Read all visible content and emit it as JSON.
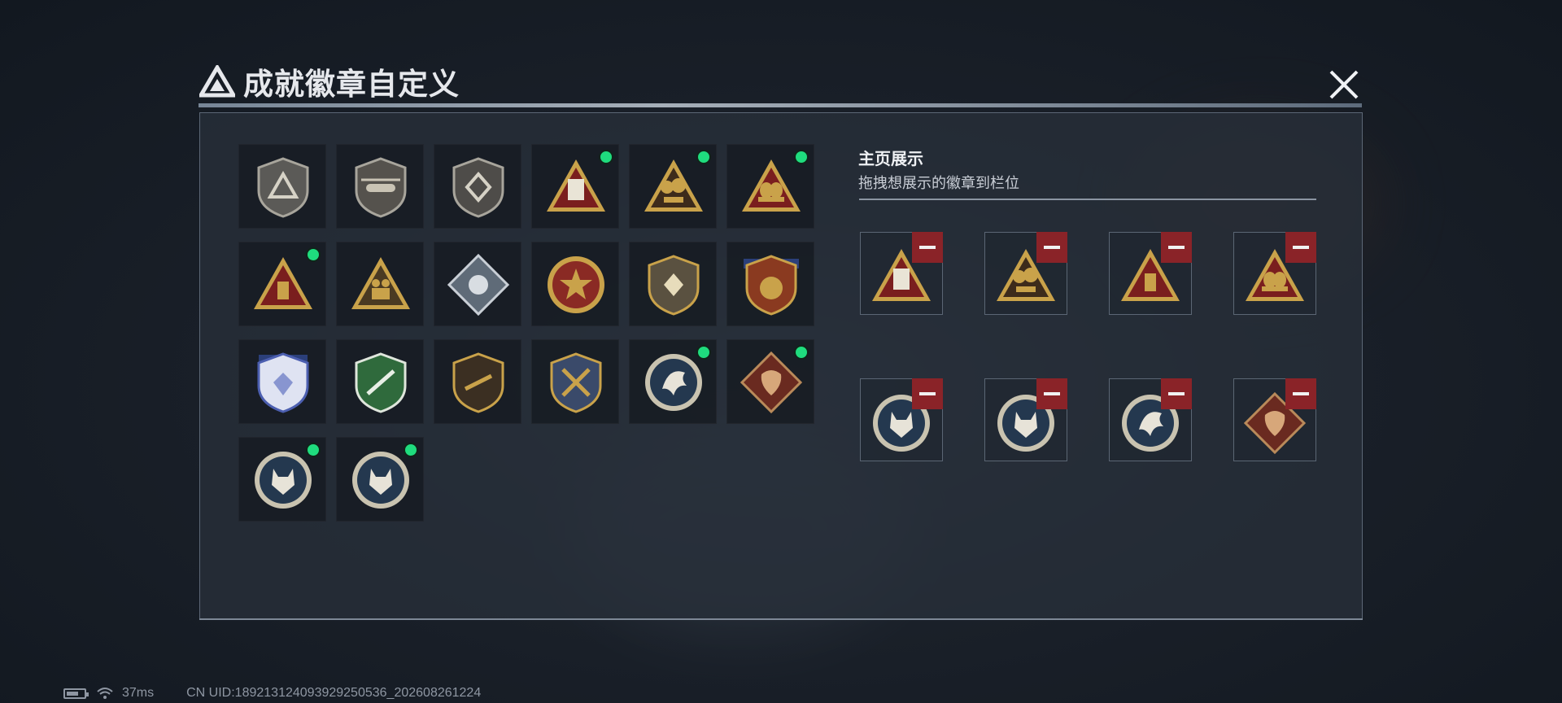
{
  "title": "成就徽章自定义",
  "showcase": {
    "title": "主页展示",
    "hint": "拖拽想展示的徽章到栏位"
  },
  "badge_grid": [
    {
      "icon": "gray-triangle-shield-badge-icon",
      "equipped": false
    },
    {
      "icon": "helicopter-shield-badge-icon",
      "equipped": false
    },
    {
      "icon": "gray-emblem-shield-badge-icon",
      "equipped": false
    },
    {
      "icon": "red-triangle-58-badge-icon",
      "equipped": true
    },
    {
      "icon": "gold-treasure-triangle-badge-icon",
      "equipped": true
    },
    {
      "icon": "gold-egg-triangle-badge-icon",
      "equipped": true
    },
    {
      "icon": "gold-bar-triangle-badge-icon",
      "equipped": true
    },
    {
      "icon": "soldiers-triangle-badge-icon",
      "equipped": false
    },
    {
      "icon": "silver-diamond-badge-icon",
      "equipped": false
    },
    {
      "icon": "red-star-round-badge-icon",
      "equipped": false
    },
    {
      "icon": "gold-shield-badge-icon",
      "equipped": false
    },
    {
      "icon": "blue-winged-gold-badge-icon",
      "equipped": false
    },
    {
      "icon": "blue-gem-shield-badge-icon",
      "equipped": false
    },
    {
      "icon": "green-rifle-shield-badge-icon",
      "equipped": false
    },
    {
      "icon": "brown-rifle-shield-badge-icon",
      "equipped": false
    },
    {
      "icon": "gold-crossed-rifles-badge-icon",
      "equipped": false
    },
    {
      "icon": "eagle-round-badge-icon",
      "equipped": true
    },
    {
      "icon": "dragon-diamond-badge-icon",
      "equipped": true
    },
    {
      "icon": "wolf-round-badge-icon",
      "equipped": true
    },
    {
      "icon": "wolf-round-badge-icon",
      "equipped": true
    }
  ],
  "showcase_slots": [
    {
      "icon": "red-triangle-58-badge-icon"
    },
    {
      "icon": "gold-treasure-triangle-badge-icon"
    },
    {
      "icon": "gold-bar-triangle-badge-icon"
    },
    {
      "icon": "gold-egg-triangle-badge-icon"
    },
    {
      "icon": "wolf-round-badge-icon"
    },
    {
      "icon": "wolf-round-badge-icon"
    },
    {
      "icon": "eagle-round-badge-icon"
    },
    {
      "icon": "dragon-diamond-badge-icon"
    }
  ],
  "status_bar": {
    "ping": "37ms",
    "uid": "CN UID:189213124093929250536_202608261224"
  },
  "colors": {
    "equipped_dot": "#1fdc7e",
    "remove_button": "#8a2328",
    "badge_gold": "#c9a24a",
    "badge_red": "#7a1e1e"
  }
}
